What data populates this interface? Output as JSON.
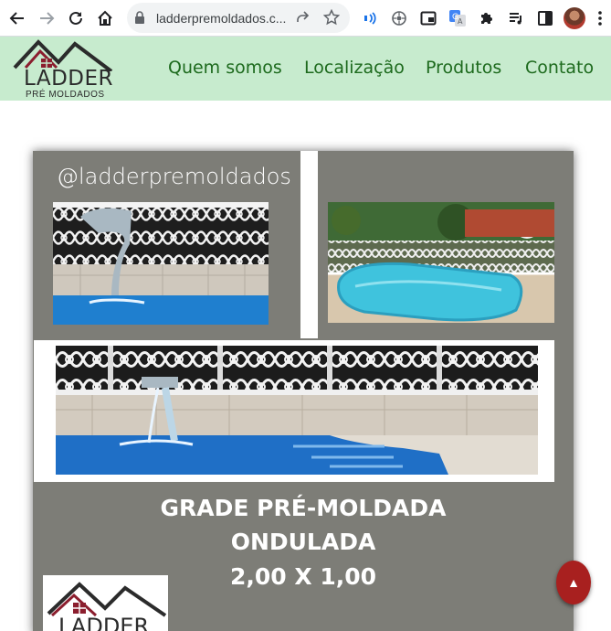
{
  "browser": {
    "url": "ladderpremoldados.c...",
    "icons": [
      "back-arrow-icon",
      "forward-arrow-icon",
      "reload-icon",
      "home-icon",
      "lock-icon",
      "share-icon",
      "star-icon",
      "read-aloud-icon",
      "extension-flower-icon",
      "picture-in-picture-icon",
      "translate-icon",
      "puzzle-icon",
      "media-playlist-icon",
      "side-panel-icon",
      "profile-avatar",
      "kebab-menu-icon"
    ]
  },
  "site": {
    "logo_word": "LADDER",
    "logo_sub": "PRÉ MOLDADOS",
    "nav": [
      "Quem somos",
      "Localização",
      "Produtos",
      "Contato"
    ],
    "colors": {
      "header_bg": "#c7ebce",
      "nav_text": "#1d6a1d",
      "roof_dark": "#2b2b2b",
      "roof_red": "#8b1e2e"
    }
  },
  "post": {
    "handle": "@ladderpremoldados",
    "headline": [
      "GRADE PRÉ-MOLDADA",
      "ONDULADA",
      "2,00 X 1,00"
    ],
    "card_word": "LADDER",
    "colors": {
      "post_bg": "#7d7d77",
      "water": "#1f7fcf",
      "pool_cyan": "#3fc3dd"
    }
  },
  "scroll_top": {
    "glyph": "▲",
    "color": "#a8201f"
  }
}
